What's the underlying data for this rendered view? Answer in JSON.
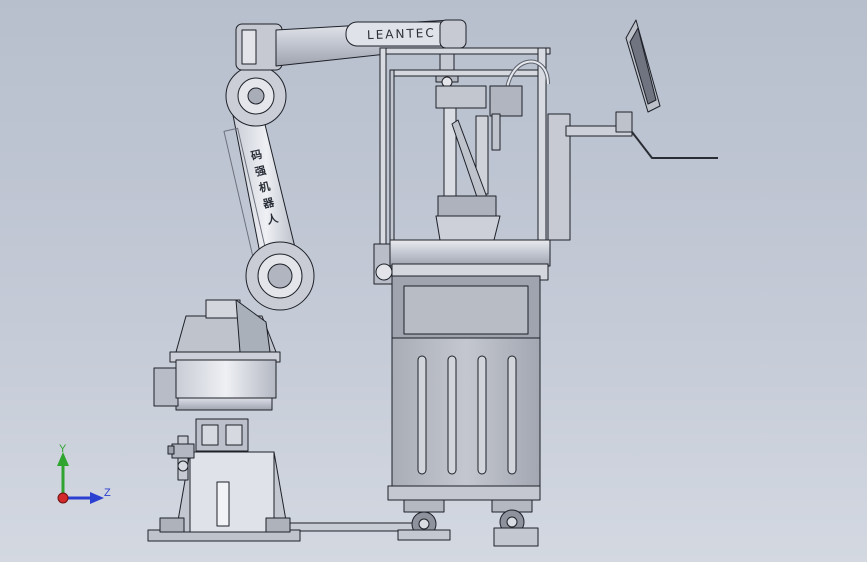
{
  "robot": {
    "brand_text": "LEANTEC",
    "arm_label_chars": [
      "码",
      "强",
      "机",
      "器",
      "人"
    ]
  },
  "triad": {
    "y_label": "Y",
    "z_label": "Z",
    "colors": {
      "y": "#2fa52f",
      "z": "#2b3fd1",
      "origin": "#d22a2a"
    }
  },
  "colors": {
    "background_top": "#b7bfcd",
    "background_bottom": "#d3d8e1",
    "metal_light": "#e2e5ec",
    "metal_mid": "#b9bdc8",
    "metal_dark": "#8b909c",
    "outline": "#1e2128"
  }
}
